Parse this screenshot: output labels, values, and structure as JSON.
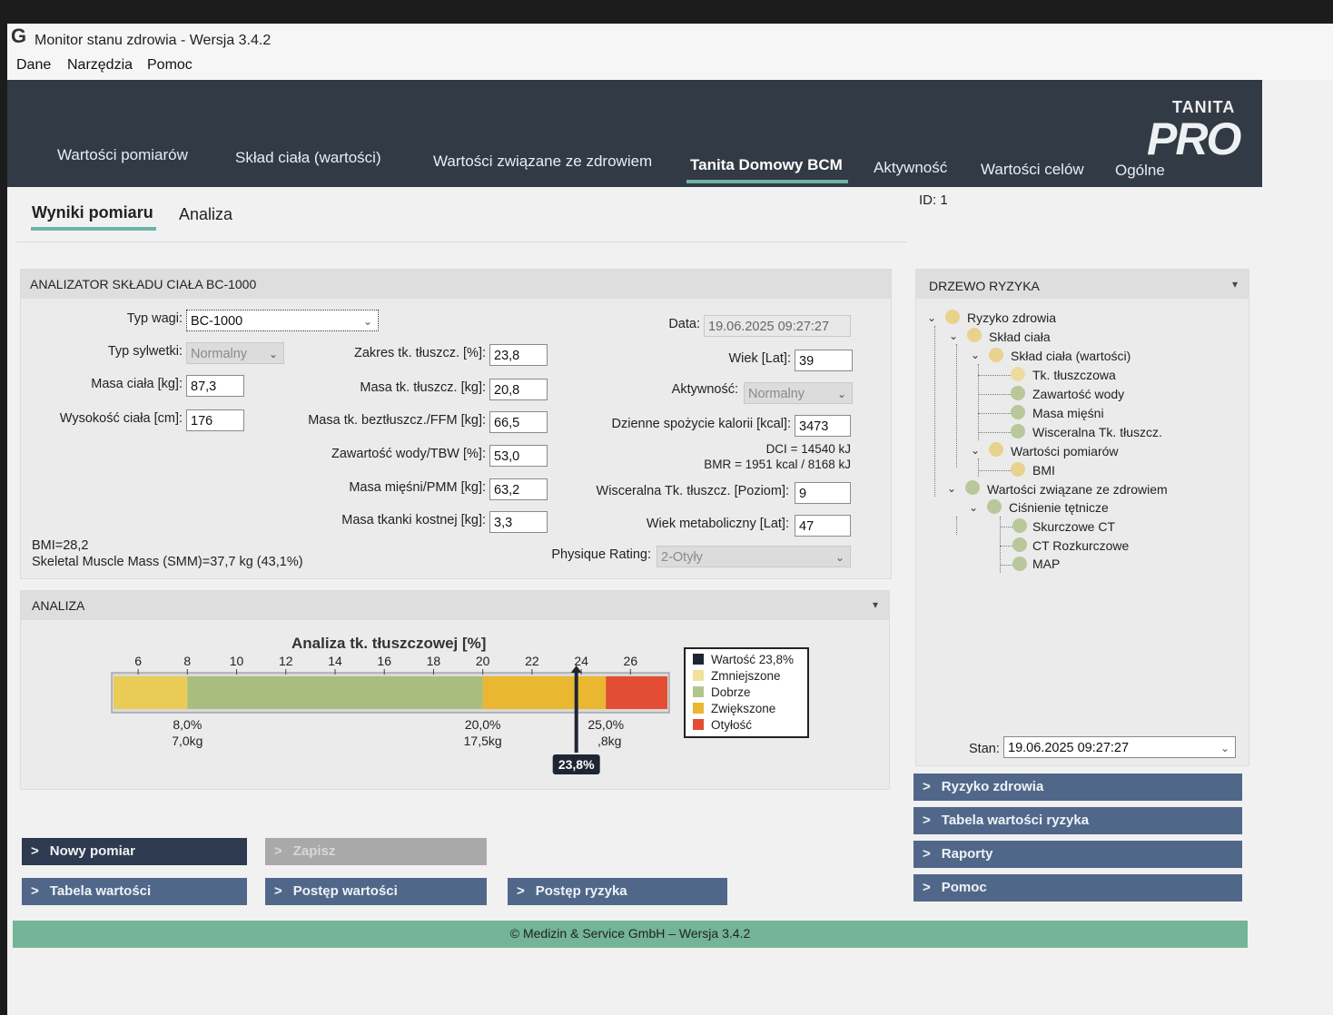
{
  "window": {
    "title": "Monitor stanu zdrowia - Wersja 3.4.2",
    "icon": "G"
  },
  "menu": [
    "Dane",
    "Narzędzia",
    "Pomoc"
  ],
  "nav_tabs": [
    {
      "label": "Wartości pomiarów"
    },
    {
      "label": "Skład ciała (wartości)"
    },
    {
      "label": "Wartości związane ze zdrowiem"
    },
    {
      "label": "Tanita Domowy BCM",
      "active": true
    },
    {
      "label": "Aktywność"
    },
    {
      "label": "Wartości celów"
    },
    {
      "label": "Ogólne"
    }
  ],
  "logo": {
    "brand": "TANITA",
    "product": "PRO"
  },
  "sub_tabs": [
    {
      "label": "Wyniki pomiaru",
      "active": true
    },
    {
      "label": "Analiza"
    }
  ],
  "id_label": "ID: 1",
  "analyzer": {
    "title": "ANALIZATOR SKŁADU CIAŁA BC-1000",
    "typ_wagi": {
      "label": "Typ wagi:",
      "value": "BC-1000"
    },
    "typ_sylwetki": {
      "label": "Typ sylwetki:",
      "value": "Normalny"
    },
    "masa_ciala": {
      "label": "Masa ciała [kg]:",
      "value": "87,3"
    },
    "wysokosc": {
      "label": "Wysokość ciała [cm]:",
      "value": "176"
    },
    "zakres_tluszcz": {
      "label": "Zakres tk. tłuszcz. [%]:",
      "value": "23,8"
    },
    "masa_tluszcz": {
      "label": "Masa tk. tłuszcz. [kg]:",
      "value": "20,8"
    },
    "ffm": {
      "label": "Masa tk. beztłuszcz./FFM [kg]:",
      "value": "66,5"
    },
    "tbw": {
      "label": "Zawartość wody/TBW [%]:",
      "value": "53,0"
    },
    "pmm": {
      "label": "Masa mięśni/PMM [kg]:",
      "value": "63,2"
    },
    "kostna": {
      "label": "Masa tkanki kostnej [kg]:",
      "value": "3,3"
    },
    "data": {
      "label": "Data:",
      "value": "19.06.2025 09:27:27"
    },
    "wiek": {
      "label": "Wiek [Lat]:",
      "value": "39"
    },
    "aktywnosc": {
      "label": "Aktywność:",
      "value": "Normalny"
    },
    "kalorie": {
      "label": "Dzienne spożycie kalorii [kcal]:",
      "value": "3473"
    },
    "dci": "DCI = 14540 kJ",
    "bmr": "BMR = 1951 kcal / 8168 kJ",
    "wisceralna": {
      "label": "Wisceralna Tk. tłuszcz. [Poziom]:",
      "value": "9"
    },
    "wiek_metaboliczny": {
      "label": "Wiek metaboliczny [Lat]:",
      "value": "47"
    },
    "physique": {
      "label": "Physique Rating:",
      "value": "2-Otyły"
    },
    "bmi_text": "BMI=28,2",
    "smm_text": "Skeletal Muscle Mass (SMM)=37,7 kg (43,1%)"
  },
  "analiza": {
    "title": "ANALIZA",
    "chart_title": "Analiza tk. tłuszczowej [%]",
    "ticks": [
      "6",
      "8",
      "10",
      "12",
      "14",
      "16",
      "18",
      "20",
      "22",
      "24",
      "26"
    ],
    "thresholds": [
      {
        "pct": "8,0%",
        "kg": "7,0kg"
      },
      {
        "pct": "20,0%",
        "kg": "17,5kg"
      },
      {
        "pct": "25,0%",
        "kg": ",8kg"
      }
    ],
    "marker_label": "23,8%",
    "legend": [
      {
        "label": "Wartość 23,8%",
        "color": "#1f2633"
      },
      {
        "label": "Zmniejszone",
        "color": "#efe39a"
      },
      {
        "label": "Dobrze",
        "color": "#b3c58f"
      },
      {
        "label": "Zwiększone",
        "color": "#e9b730"
      },
      {
        "label": "Otyłość",
        "color": "#e24d33"
      }
    ]
  },
  "chart_data": {
    "type": "bar",
    "title": "Analiza tk. tłuszczowej [%]",
    "xlim": [
      5,
      27.5
    ],
    "bands": [
      {
        "name": "Zmniejszone",
        "from": 5,
        "to": 8,
        "color": "#eacb55"
      },
      {
        "name": "Dobrze",
        "from": 8,
        "to": 20,
        "color": "#a9bd80"
      },
      {
        "name": "Zwiększone",
        "from": 20,
        "to": 25,
        "color": "#e9b730"
      },
      {
        "name": "Otyłość",
        "from": 25,
        "to": 27.5,
        "color": "#e24d33"
      }
    ],
    "value": 23.8
  },
  "risk_tree": {
    "title": "DRZEWO RYZYKA",
    "items": [
      {
        "label": "Ryzyko zdrowia",
        "color": "#e8d28e"
      },
      {
        "label": "Skład ciała",
        "color": "#e8d28e"
      },
      {
        "label": "Skład ciała (wartości)",
        "color": "#e8d28e"
      },
      {
        "label": "Tk. tłuszczowa",
        "color": "#eedc9e"
      },
      {
        "label": "Zawartość wody",
        "color": "#b9c79a"
      },
      {
        "label": "Masa mięśni",
        "color": "#b9c79a"
      },
      {
        "label": "Wisceralna Tk. tłuszcz.",
        "color": "#b9c79a"
      },
      {
        "label": "Wartości pomiarów",
        "color": "#e8d28e"
      },
      {
        "label": "BMI",
        "color": "#e8d28e"
      },
      {
        "label": "Wartości związane ze zdrowiem",
        "color": "#b9c79a"
      },
      {
        "label": "Ciśnienie tętnicze",
        "color": "#b9c79a"
      },
      {
        "label": "Skurczowe CT",
        "color": "#b9c79a"
      },
      {
        "label": "CT Rozkurczowe",
        "color": "#b9c79a"
      },
      {
        "label": "MAP",
        "color": "#b9c79a"
      }
    ],
    "stan_label": "Stan:",
    "stan_value": "19.06.2025 09:27:27"
  },
  "right_buttons": [
    "Ryzyko zdrowia",
    "Tabela wartości ryzyka",
    "Raporty",
    "Pomoc"
  ],
  "bottom_buttons": {
    "nowy": "Nowy pomiar",
    "zapisz": "Zapisz",
    "tabela": "Tabela wartości",
    "postep_wartosci": "Postęp wartości",
    "postep_ryzyka": "Postęp ryzyka"
  },
  "footer": "© Medizin & Service GmbH – Wersja 3.4.2"
}
